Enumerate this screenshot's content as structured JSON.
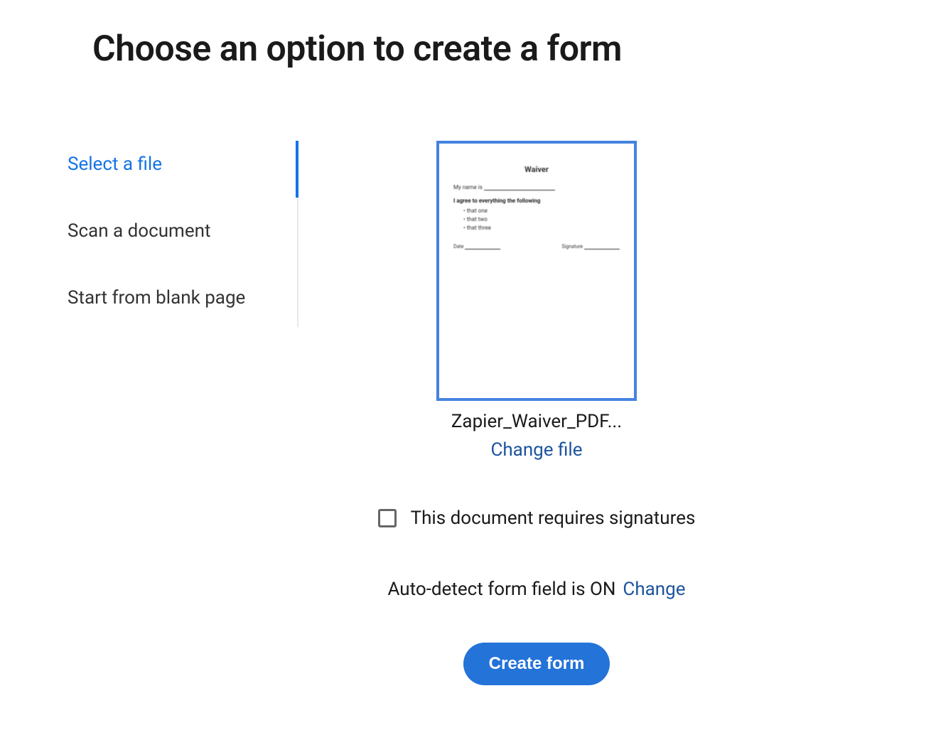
{
  "title": "Choose an option to create a form",
  "sidebar": {
    "items": [
      {
        "label": "Select a file",
        "active": true
      },
      {
        "label": "Scan a document",
        "active": false
      },
      {
        "label": "Start from blank page",
        "active": false
      }
    ]
  },
  "preview": {
    "filename": "Zapier_Waiver_PDF...",
    "change_file_label": "Change file",
    "doc": {
      "title": "Waiver",
      "name_line": "My name is",
      "agree_line": "I agree to everything the following",
      "bullets": [
        "that one",
        "that two",
        "that three"
      ],
      "date_label": "Date",
      "signature_label": "Signature"
    }
  },
  "signatures": {
    "checkbox_checked": false,
    "label": "This document requires signatures"
  },
  "autodetect": {
    "label": "Auto-detect form field is ON",
    "change_label": "Change"
  },
  "actions": {
    "create_label": "Create form"
  }
}
